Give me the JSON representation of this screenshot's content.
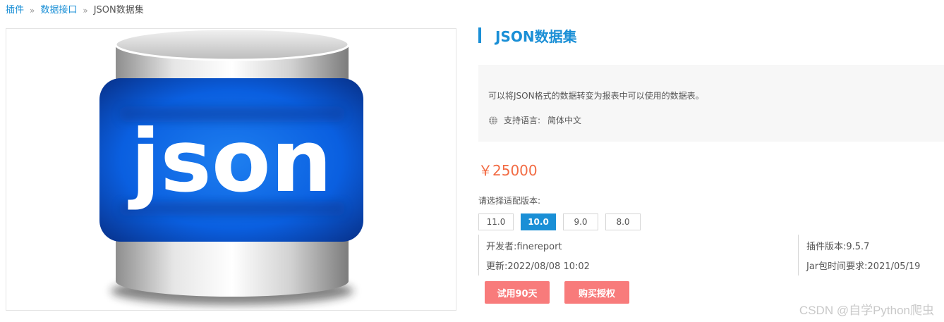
{
  "breadcrumb": {
    "items": [
      "插件",
      "数据接口"
    ],
    "separator": "»",
    "current": "JSON数据集"
  },
  "hero": {
    "logo_text": "json",
    "icon": "database-json-icon"
  },
  "product": {
    "title": "JSON数据集",
    "description": "可以将JSON格式的数据转变为报表中可以使用的数据表。",
    "language_label": "支持语言:",
    "language_value": "简体中文",
    "price": "￥25000"
  },
  "versions": {
    "label": "请选择适配版本:",
    "options": [
      "11.0",
      "10.0",
      "9.0",
      "8.0"
    ],
    "selected": "10.0"
  },
  "meta": {
    "developer": "开发者:finereport",
    "updated": "更新:2022/08/08 10:02",
    "plugin_version": "插件版本:9.5.7",
    "jar_requirement": "Jar包时间要求:2021/05/19"
  },
  "actions": {
    "trial": "试用90天",
    "buy": "购买授权"
  },
  "watermark": "CSDN @自学Python爬虫",
  "colors": {
    "accent": "#1a8fd6",
    "price": "#f26b43",
    "button": "#f87b7b"
  }
}
